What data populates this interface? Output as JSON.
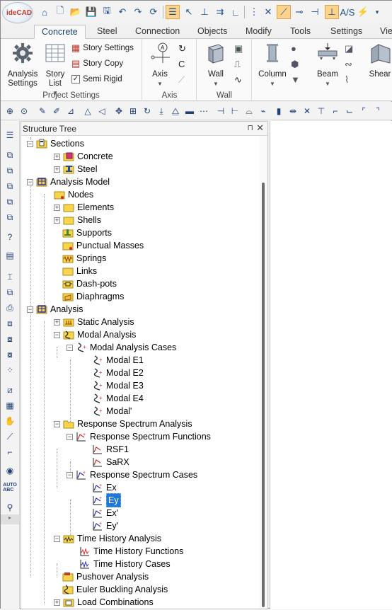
{
  "app": {
    "logo_text": "ideCAD"
  },
  "tabs": [
    {
      "label": "Concrete",
      "active": true
    },
    {
      "label": "Steel"
    },
    {
      "label": "Connection"
    },
    {
      "label": "Objects"
    },
    {
      "label": "Modify"
    },
    {
      "label": "Tools"
    },
    {
      "label": "Settings"
    },
    {
      "label": "Vie"
    }
  ],
  "ribbon": {
    "project_settings": {
      "title": "Project Settings",
      "analysis_settings": "Analysis Settings",
      "story_list": "Story List",
      "story_settings": "Story Settings",
      "story_copy": "Story Copy",
      "semi_rigid": "Semi Rigid",
      "semi_rigid_checked": true
    },
    "axis": {
      "title": "Axis",
      "axis_label": "Axis"
    },
    "wall": {
      "title": "Wall",
      "wall_label": "Wall"
    },
    "members": {
      "column": "Column",
      "beam": "Beam",
      "shear": "Shear"
    }
  },
  "panel": {
    "title": "Structure Tree",
    "pin": "⊓",
    "close": "✕"
  },
  "tree": [
    {
      "label": "Sections"
    },
    {
      "label": "Concrete"
    },
    {
      "label": "Steel"
    },
    {
      "label": "Analysis Model"
    },
    {
      "label": "Nodes"
    },
    {
      "label": "Elements"
    },
    {
      "label": "Shells"
    },
    {
      "label": "Supports"
    },
    {
      "label": "Punctual Masses"
    },
    {
      "label": "Springs"
    },
    {
      "label": "Links"
    },
    {
      "label": "Dash-pots"
    },
    {
      "label": "Diaphragms"
    },
    {
      "label": "Analysis"
    },
    {
      "label": "Static Analysis"
    },
    {
      "label": "Modal Analysis"
    },
    {
      "label": "Modal Analysis Cases"
    },
    {
      "label": "Modal E1"
    },
    {
      "label": "Modal E2"
    },
    {
      "label": "Modal E3"
    },
    {
      "label": "Modal E4"
    },
    {
      "label": "Modal'"
    },
    {
      "label": "Response Spectrum Analysis"
    },
    {
      "label": "Response Spectrum Functions"
    },
    {
      "label": "RSF1"
    },
    {
      "label": "SaRX"
    },
    {
      "label": "Response Spectrum Cases"
    },
    {
      "label": "Ex"
    },
    {
      "label": "Ey",
      "selected": true
    },
    {
      "label": "Ex'"
    },
    {
      "label": "Ey'"
    },
    {
      "label": "Time History Analysis"
    },
    {
      "label": "Time History Functions"
    },
    {
      "label": "Time History Cases"
    },
    {
      "label": "Pushover Analysis"
    },
    {
      "label": "Euler Buckling Analysis"
    },
    {
      "label": "Load Combinations"
    }
  ],
  "colors": {
    "accent": "#1e78d7",
    "folder_yellow": "#f7d54a",
    "ribbon_active": "#fbd38a"
  }
}
